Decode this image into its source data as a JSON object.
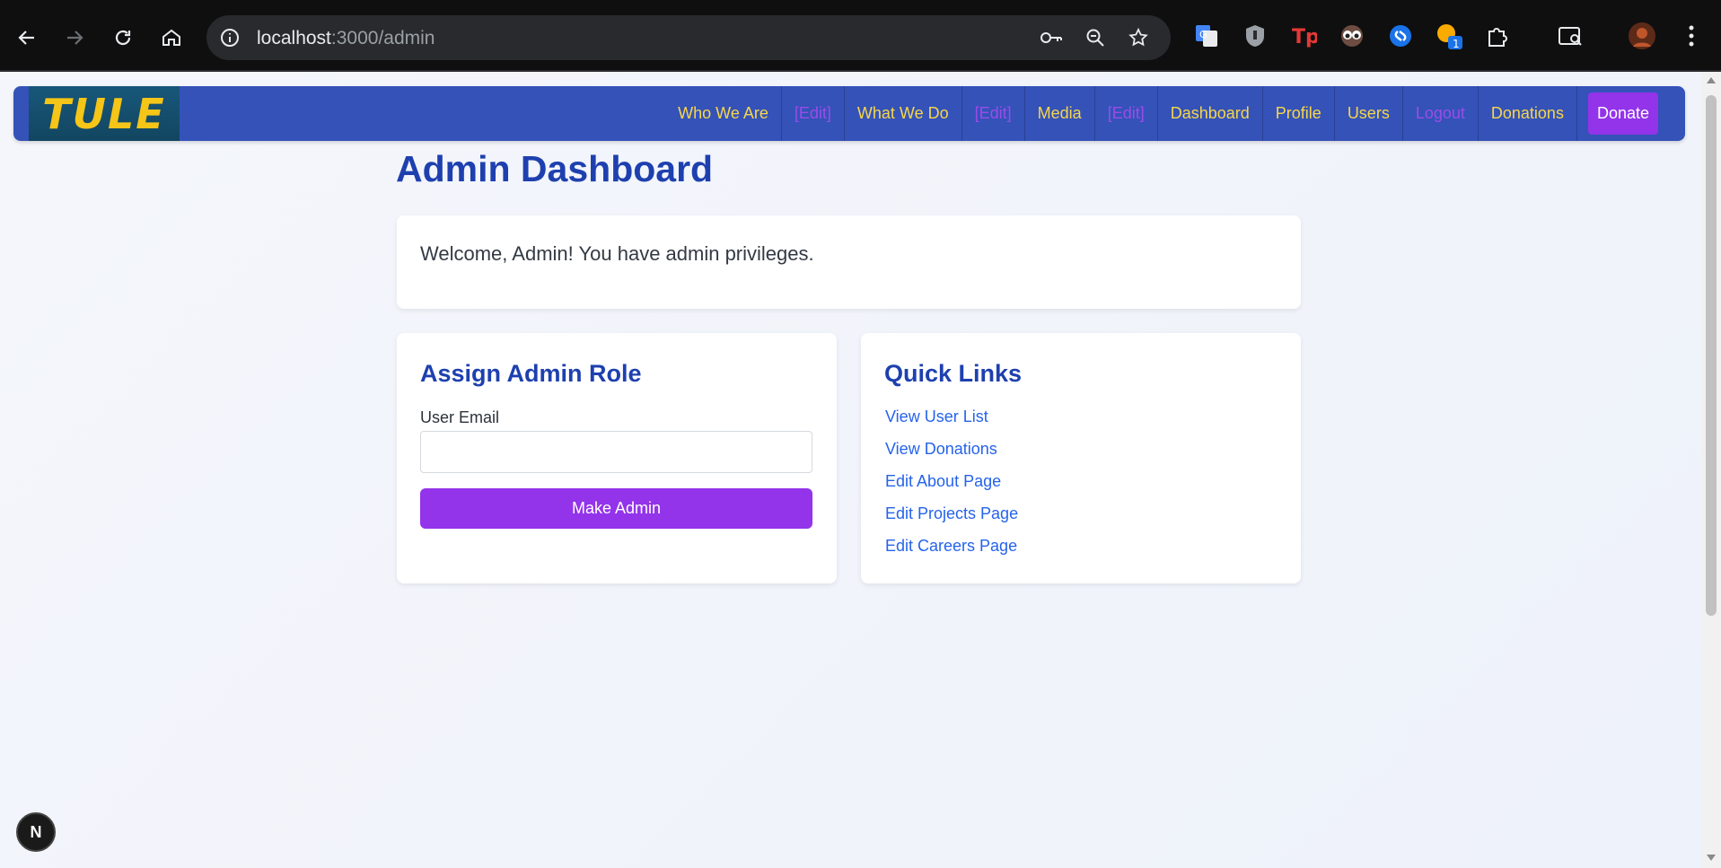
{
  "browser": {
    "url_host": "localhost",
    "url_path": ":3000/admin"
  },
  "nav": {
    "logo_text": "TULE",
    "items": [
      {
        "label": "Who We Are",
        "kind": "link"
      },
      {
        "label": "[Edit]",
        "kind": "edit"
      },
      {
        "label": "What We Do",
        "kind": "link"
      },
      {
        "label": "[Edit]",
        "kind": "edit"
      },
      {
        "label": "Media",
        "kind": "link"
      },
      {
        "label": "[Edit]",
        "kind": "edit"
      },
      {
        "label": "Dashboard",
        "kind": "link"
      },
      {
        "label": "Profile",
        "kind": "link"
      },
      {
        "label": "Users",
        "kind": "link"
      },
      {
        "label": "Logout",
        "kind": "logout"
      },
      {
        "label": "Donations",
        "kind": "link"
      }
    ],
    "donate_label": "Donate"
  },
  "page": {
    "title": "Admin Dashboard",
    "welcome": "Welcome, Admin! You have admin privileges."
  },
  "assign": {
    "heading": "Assign Admin Role",
    "email_label": "User Email",
    "email_value": "",
    "button": "Make Admin"
  },
  "quick_links": {
    "heading": "Quick Links",
    "items": [
      "View User List",
      "View Donations",
      "Edit About Page",
      "Edit Projects Page",
      "Edit Careers Page"
    ]
  },
  "dev_badge": "N",
  "colors": {
    "nav_bg": "#3452b8",
    "nav_link": "#f7d64a",
    "nav_edit": "#9b4ce8",
    "accent_purple": "#9333ea",
    "heading_blue": "#1e40af",
    "link_blue": "#2563eb"
  }
}
